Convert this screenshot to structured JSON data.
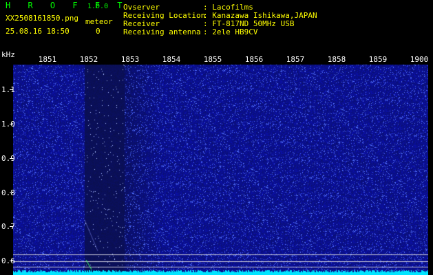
{
  "header": {
    "app_title": "H R O F F T",
    "version": "1.0.0",
    "filename": "XX2508161850.png",
    "meteor_label": "meteor",
    "datetime": "25.08.16 18:50",
    "meteor_count": "0"
  },
  "info": {
    "rows": [
      {
        "label": "Ovserver",
        "value": ": Lacofilms"
      },
      {
        "label": "Receiving Location",
        "value": ": Kanazawa Ishikawa,JAPAN"
      },
      {
        "label": "Receiver",
        "value": ": FT-817ND 50MHz USB"
      },
      {
        "label": "Receiving antenna",
        "value": ": 2ele HB9CV"
      }
    ]
  },
  "axes": {
    "y_unit": "kHz",
    "x_ticks": [
      "1851",
      "1852",
      "1853",
      "1854",
      "1855",
      "1856",
      "1857",
      "1858",
      "1859",
      "1900"
    ],
    "y_ticks": [
      "1.1",
      "1.0",
      "0.9",
      "0.8",
      "0.7",
      "0.6"
    ]
  },
  "colors": {
    "background": "#000000",
    "title_green": "#00ff00",
    "meta_yellow": "#ffff00",
    "noise_dark_blue": "#0a0f6e",
    "noise_bright_blue": "#4d6bff",
    "spectrum_cyan": "#00e5ff"
  }
}
